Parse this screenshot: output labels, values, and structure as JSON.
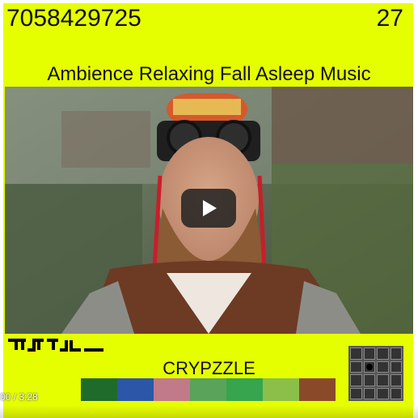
{
  "header": {
    "code": "7058429725",
    "count": "27"
  },
  "video": {
    "title": "Ambience Relaxing Fall Asleep Music",
    "time": "00 / 3:28",
    "play_icon": "play-icon"
  },
  "puzzle": {
    "label": "CRYPZZLE",
    "glyphs_icon": "glyph-strip-icon",
    "grid_icon": "grid-icon",
    "swatches": [
      "#1f6b2c",
      "#2c57a8",
      "#c07a8a",
      "#5aa35a",
      "#36a54e",
      "#8bbf4a",
      "#8a4a2a"
    ]
  }
}
